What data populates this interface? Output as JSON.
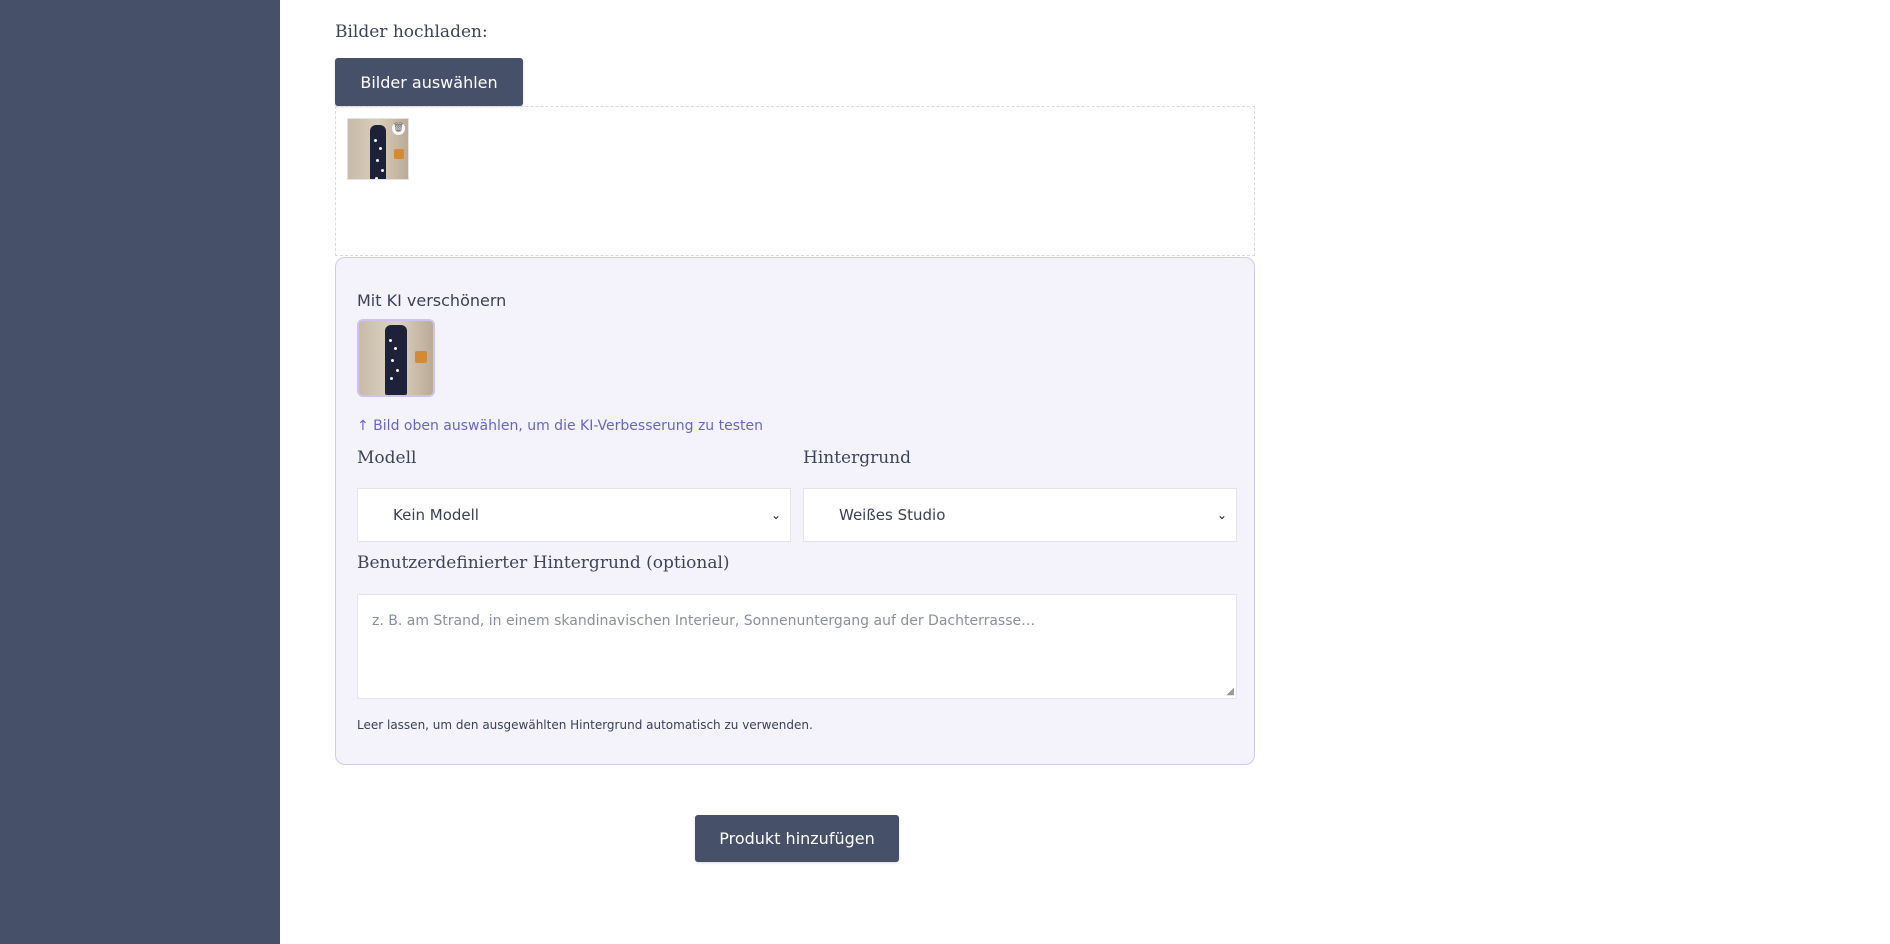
{
  "upload": {
    "label": "Bilder hochladen:",
    "select_button": "Bilder auswählen"
  },
  "dropzone": {
    "images": [
      {
        "icon": "trash-icon"
      }
    ]
  },
  "ai_panel": {
    "title": "Mit KI verschönern",
    "hint": "↑ Bild oben auswählen, um die KI-Verbesserung zu testen",
    "model_label": "Modell",
    "model_value": "Kein Modell",
    "background_label": "Hintergrund",
    "background_value": "Weißes Studio",
    "custom_label": "Benutzerdefinierter Hintergrund (optional)",
    "custom_placeholder": "z. B. am Strand, in einem skandinavischen Interieur, Sonnenuntergang auf der Dachterrasse…",
    "helper": "Leer lassen, um den ausgewählten Hintergrund automatisch zu verwenden."
  },
  "submit": {
    "label": "Produkt hinzufügen"
  },
  "colors": {
    "sidebar": "#475069",
    "button": "#475069",
    "panel_bg": "#f4f3fc",
    "panel_border": "#cfcaf0",
    "hint_text": "#6a64c8"
  }
}
